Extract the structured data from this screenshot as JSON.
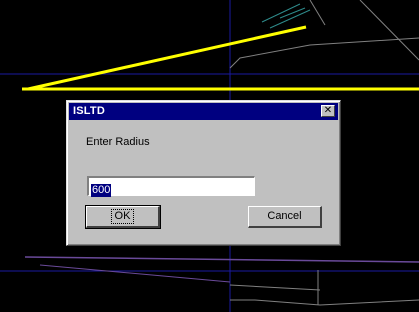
{
  "dialog": {
    "title": "ISLTD",
    "close_glyph": "✕",
    "prompt": "Enter Radius",
    "input_value": "600",
    "ok_label": "OK",
    "cancel_label": "Cancel"
  },
  "colors": {
    "desktop_background": "#000000",
    "highlight_line": "#ffff00",
    "grid_line": "#1a1aa0",
    "wire_line": "#808080",
    "accent_line": "#2e8b8b",
    "purple_line": "#6a4a9a",
    "titlebar": "#000080",
    "dialog_face": "#c0c0c0"
  }
}
